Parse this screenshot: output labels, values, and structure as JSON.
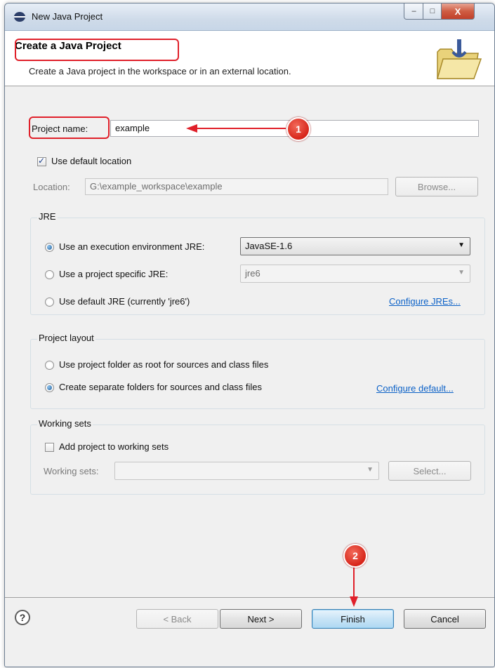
{
  "window": {
    "title": "New Java Project",
    "controls": {
      "minimize": "–",
      "maximize": "□",
      "close": "X"
    }
  },
  "header": {
    "title": "Create a Java Project",
    "description": "Create a Java project in the workspace or in an external location."
  },
  "project": {
    "name_label": "Project name:",
    "name_value": "example"
  },
  "location": {
    "use_default_label": "Use default location",
    "use_default_checked": true,
    "label": "Location:",
    "value": "G:\\example_workspace\\example",
    "browse_label": "Browse..."
  },
  "jre": {
    "group_label": "JRE",
    "options": [
      {
        "label": "Use an execution environment JRE:",
        "selected": true
      },
      {
        "label": "Use a project specific JRE:",
        "selected": false
      },
      {
        "label": "Use default JRE (currently 'jre6')",
        "selected": false
      }
    ],
    "execution_env_value": "JavaSE-1.6",
    "project_jre_value": "jre6",
    "configure_link": "Configure JREs..."
  },
  "layout": {
    "group_label": "Project layout",
    "options": [
      {
        "label": "Use project folder as root for sources and class files",
        "selected": false
      },
      {
        "label": "Create separate folders for sources and class files",
        "selected": true
      }
    ],
    "configure_link": "Configure default..."
  },
  "working_sets": {
    "group_label": "Working sets",
    "add_label": "Add project to working sets",
    "add_checked": false,
    "label": "Working sets:",
    "value": "",
    "select_label": "Select..."
  },
  "buttons": {
    "help": "?",
    "back": "< Back",
    "next": "Next >",
    "finish": "Finish",
    "cancel": "Cancel"
  },
  "annotations": {
    "badge1": "1",
    "badge2": "2",
    "color": "#e0202a"
  }
}
